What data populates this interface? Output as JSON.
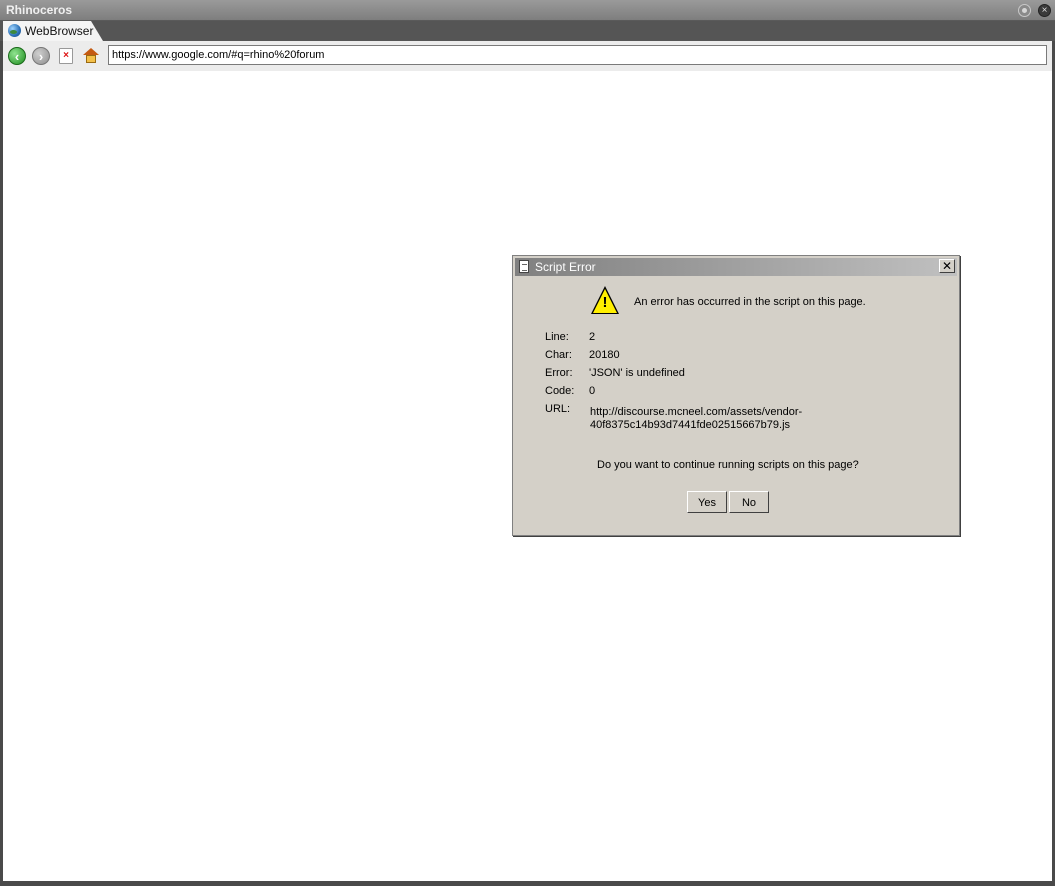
{
  "window": {
    "title": "Rhinoceros"
  },
  "tab": {
    "label": "WebBrowser"
  },
  "toolbar": {
    "url": "https://www.google.com/#q=rhino%20forum"
  },
  "dialog": {
    "title": "Script Error",
    "message": "An error has occurred in the script on this page.",
    "fields": {
      "line_label": "Line:",
      "line_value": "2",
      "char_label": "Char:",
      "char_value": "20180",
      "error_label": "Error:",
      "error_value": "'JSON' is undefined",
      "code_label": "Code:",
      "code_value": "0",
      "url_label": "URL:",
      "url_value": "http://discourse.mcneel.com/assets/vendor-40f8375c14b93d7441fde02515667b79.js"
    },
    "question": "Do you want to continue running scripts on this page?",
    "yes_label": "Yes",
    "no_label": "No"
  },
  "icons": [
    "settings-gear-icon",
    "close-window-icon",
    "globe-icon",
    "back-icon",
    "forward-icon",
    "stop-icon",
    "home-icon",
    "document-icon",
    "dialog-close-icon",
    "warning-icon"
  ]
}
